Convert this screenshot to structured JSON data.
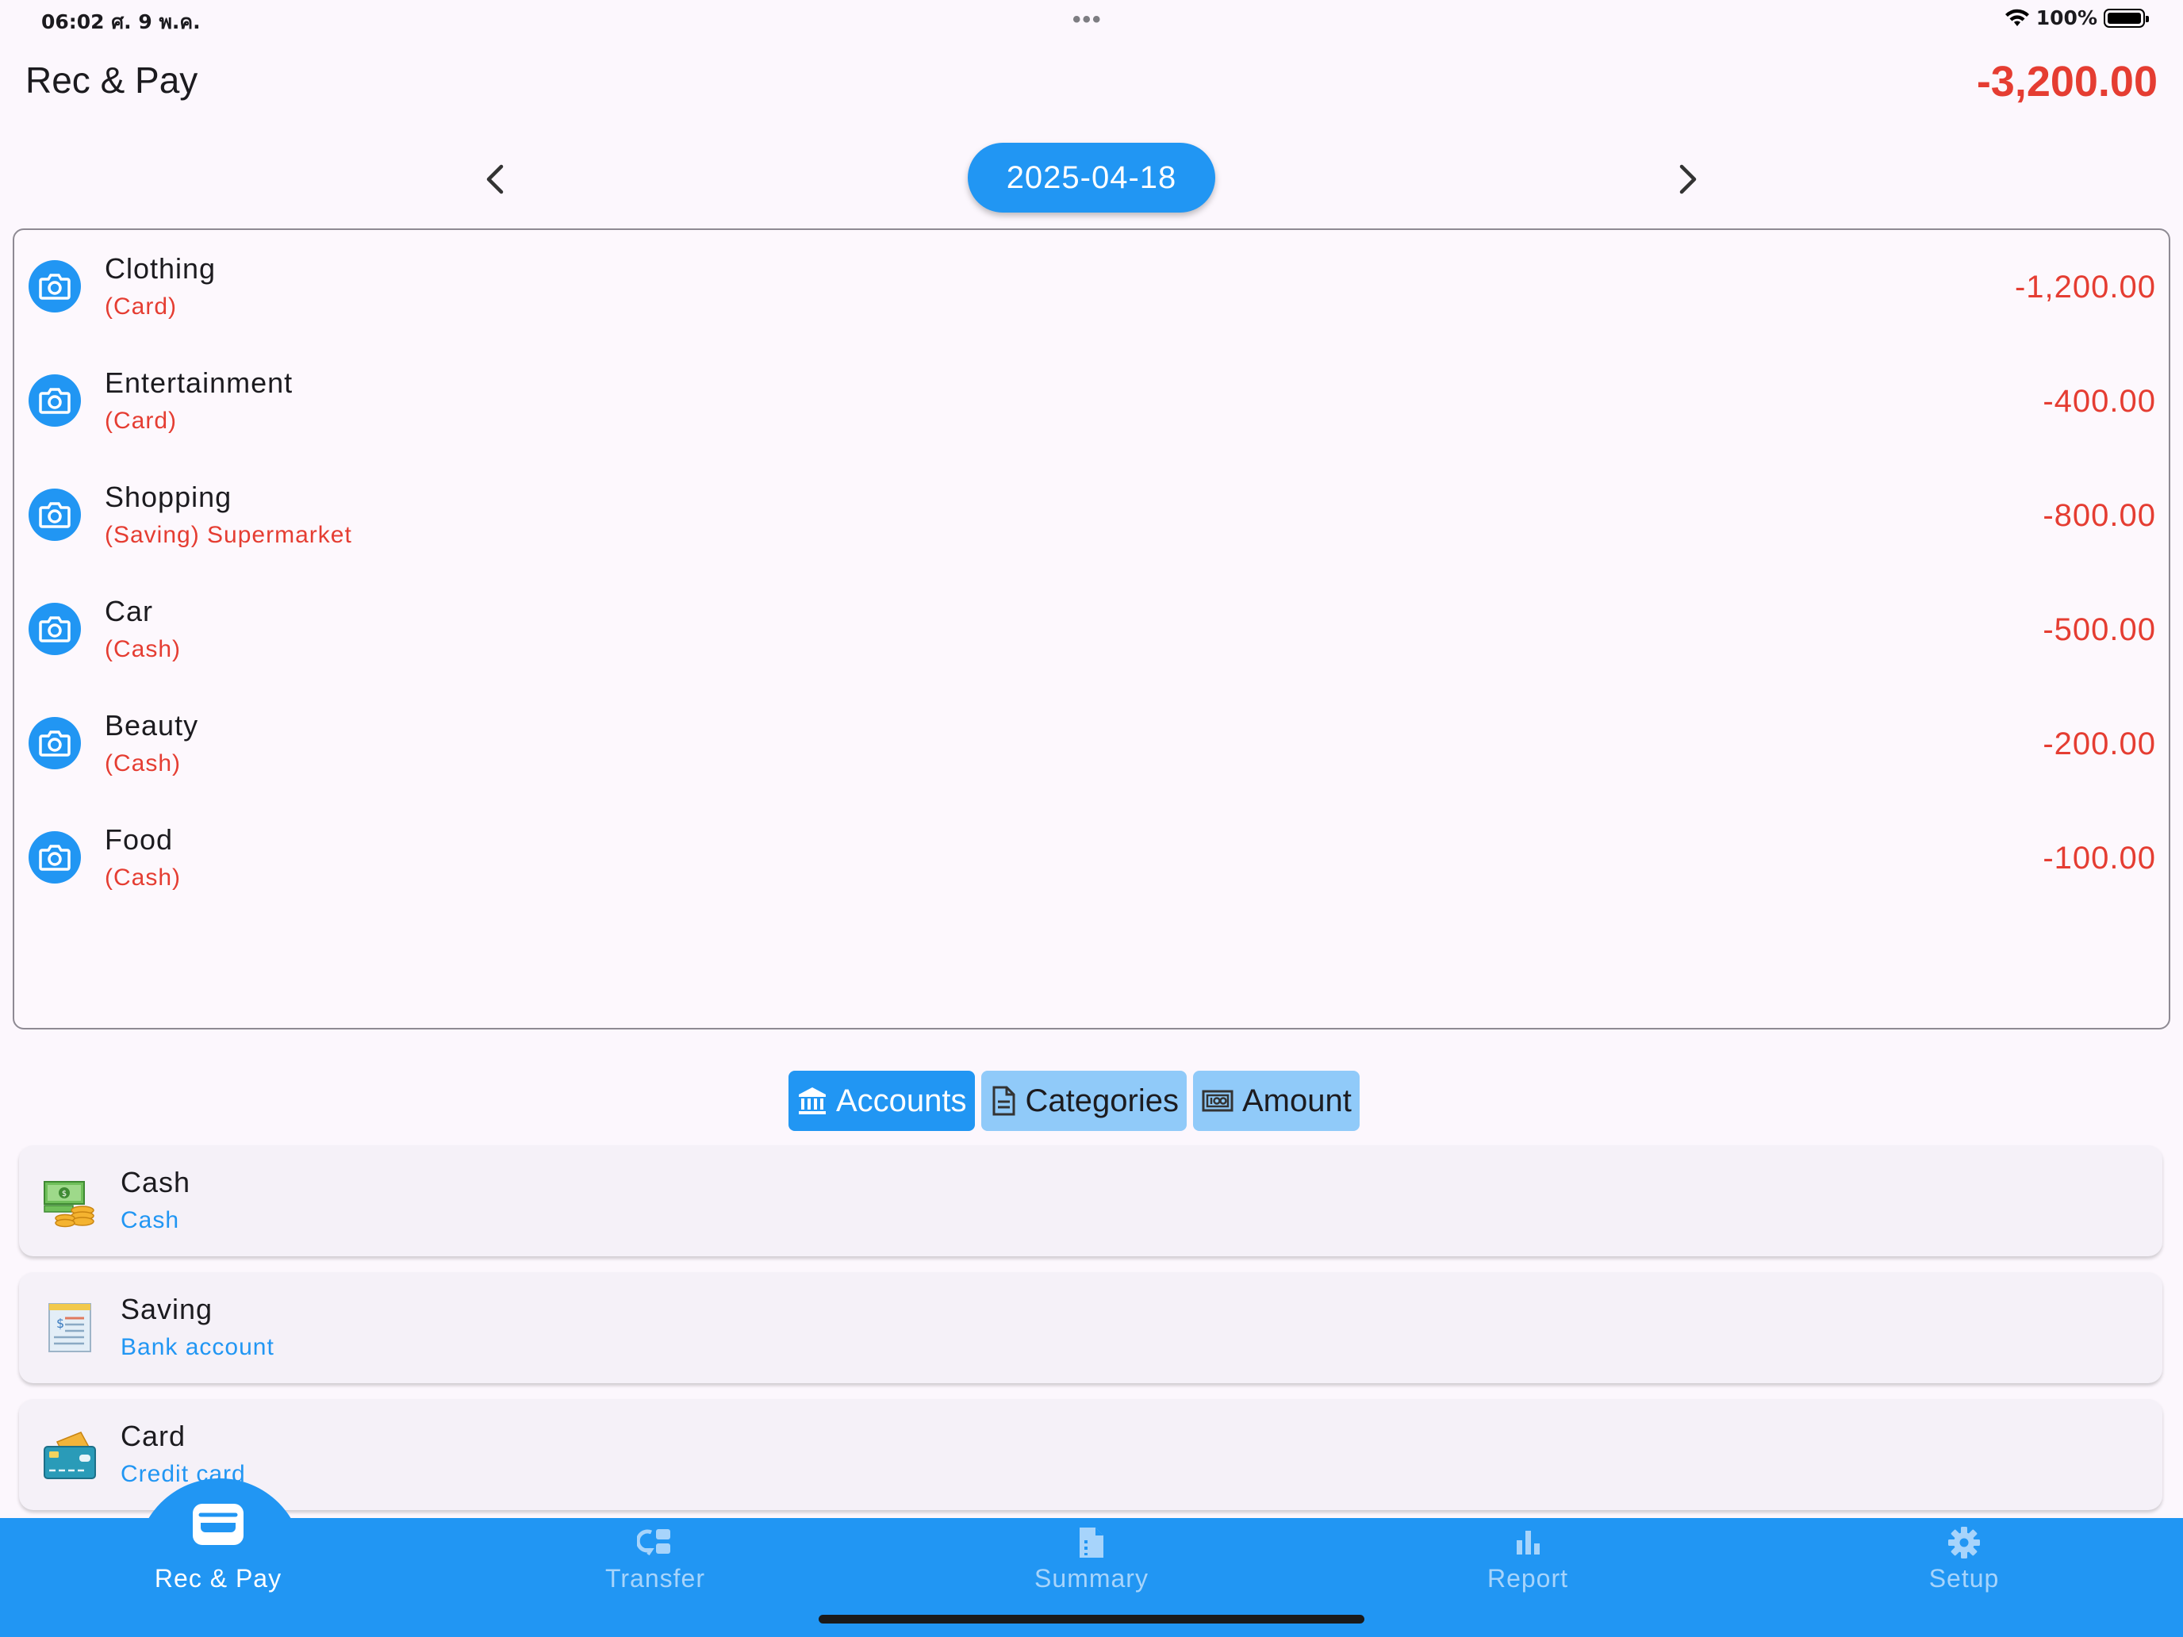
{
  "status_bar": {
    "time_date": "06:02  ศ. 9 พ.ค.",
    "dots": "•••",
    "battery_percent": "100%"
  },
  "header": {
    "title": "Rec & Pay",
    "total": "-3,200.00"
  },
  "date_nav": {
    "date": "2025-04-18"
  },
  "transactions": [
    {
      "category": "Clothing",
      "detail": "(Card)",
      "amount": "-1,200.00"
    },
    {
      "category": "Entertainment",
      "detail": "(Card)",
      "amount": "-400.00"
    },
    {
      "category": "Shopping",
      "detail": "(Saving) Supermarket",
      "amount": "-800.00"
    },
    {
      "category": "Car",
      "detail": "(Cash)",
      "amount": "-500.00"
    },
    {
      "category": "Beauty",
      "detail": "(Cash)",
      "amount": "-200.00"
    },
    {
      "category": "Food",
      "detail": "(Cash)",
      "amount": "-100.00"
    }
  ],
  "tabs": [
    {
      "label": "Accounts",
      "icon": "bank-icon",
      "active": true
    },
    {
      "label": "Categories",
      "icon": "document-icon",
      "active": false
    },
    {
      "label": "Amount",
      "icon": "money-icon",
      "active": false
    }
  ],
  "accounts": [
    {
      "name": "Cash",
      "type": "Cash",
      "icon": "cash-money-icon"
    },
    {
      "name": "Saving",
      "type": "Bank account",
      "icon": "bank-statement-icon"
    },
    {
      "name": "Card",
      "type": "Credit card",
      "icon": "credit-card-icon"
    }
  ],
  "bottom_nav": [
    {
      "label": "Rec & Pay",
      "icon": "wallet-icon",
      "active": true
    },
    {
      "label": "Transfer",
      "icon": "transfer-icon",
      "active": false
    },
    {
      "label": "Summary",
      "icon": "summary-document-icon",
      "active": false
    },
    {
      "label": "Report",
      "icon": "bar-chart-icon",
      "active": false
    },
    {
      "label": "Setup",
      "icon": "gear-icon",
      "active": false
    }
  ],
  "colors": {
    "primary": "#2196f3",
    "primary_light": "#90caf9",
    "expense": "#e53d32",
    "background": "#fcf7fd"
  }
}
